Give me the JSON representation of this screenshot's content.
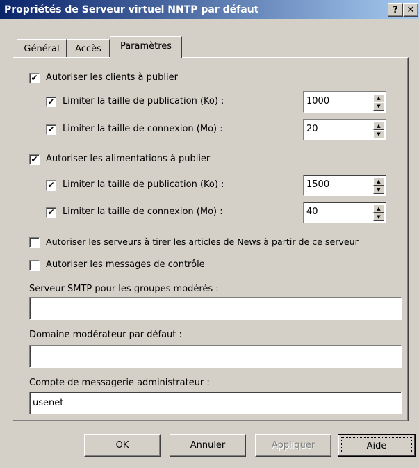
{
  "window": {
    "title": "Propriétés de Serveur virtuel NNTP par défaut",
    "help_glyph": "?",
    "close_glyph": "✕"
  },
  "tabs": [
    {
      "label": "Général"
    },
    {
      "label": "Accès"
    },
    {
      "label": "Paramètres"
    }
  ],
  "options": {
    "allow_clients": {
      "label": "Autoriser les clients à publier",
      "checked": true
    },
    "clients_post_limit": {
      "label": "Limiter la taille de publication (Ko) :",
      "checked": true,
      "value": "1000"
    },
    "clients_conn_limit": {
      "label": "Limiter la taille de connexion (Mo) :",
      "checked": true,
      "value": "20"
    },
    "allow_feeds": {
      "label": "Autoriser les alimentations à publier",
      "checked": true
    },
    "feeds_post_limit": {
      "label": "Limiter la taille de publication (Ko) :",
      "checked": true,
      "value": "1500"
    },
    "feeds_conn_limit": {
      "label": "Limiter la taille de connexion (Mo) :",
      "checked": true,
      "value": "40"
    },
    "allow_servers_pull": {
      "label": "Autoriser les serveurs à tirer les articles de News à partir de ce serveur",
      "checked": false
    },
    "allow_control": {
      "label": "Autoriser les messages de contrôle",
      "checked": false
    }
  },
  "fields": {
    "smtp": {
      "label": "Serveur SMTP pour les groupes modérés :",
      "value": ""
    },
    "moderator_domain": {
      "label": "Domaine modérateur par défaut :",
      "value": ""
    },
    "admin_email": {
      "label": "Compte de messagerie administrateur :",
      "value": "usenet"
    }
  },
  "buttons": {
    "ok": "OK",
    "cancel": "Annuler",
    "apply": "Appliquer",
    "help": "Aide"
  },
  "checkmark": "✔",
  "spin_up": "▲",
  "spin_down": "▼"
}
